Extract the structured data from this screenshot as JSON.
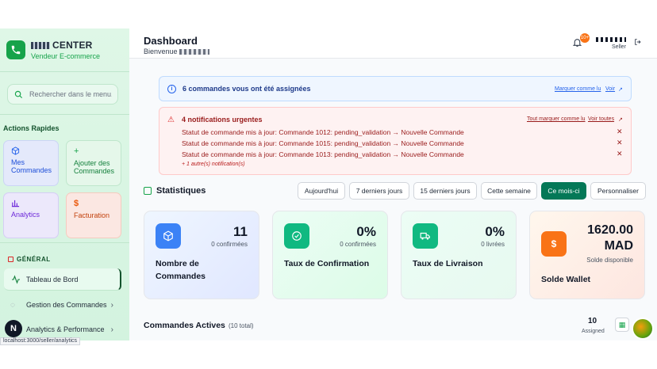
{
  "sidebar": {
    "brand_title": "CENTER",
    "brand_sub": "Vendeur E-commerce",
    "search_placeholder": "Rechercher dans le menu...",
    "quick_label": "Actions Rapides",
    "quick": [
      {
        "label": "Mes Commandes",
        "icon": "cube-icon"
      },
      {
        "label": "Ajouter des Commandes",
        "icon": "plus-icon"
      },
      {
        "label": "Analytics",
        "icon": "bar-chart-icon"
      },
      {
        "label": "Facturation",
        "icon": "dollar-icon"
      }
    ],
    "general_label": "GÉNÉRAL",
    "nav": [
      {
        "label": "Tableau de Bord",
        "active": true
      },
      {
        "label": "Gestion des Commandes"
      },
      {
        "label": "Analytics & Performance"
      }
    ],
    "badge": "N",
    "url_tip": "localhost:3000/seller/analytics"
  },
  "header": {
    "title": "Dashboard",
    "subtitle": "Bienvenue",
    "notif_count": "10+",
    "role": "Seller"
  },
  "info": {
    "text": "6 commandes vous ont été assignées",
    "mark_read": "Marquer comme lu",
    "view": "Voir"
  },
  "alert": {
    "title": "4 notifications urgentes",
    "mark_all": "Tout marquer comme lu",
    "view_all": "Voir toutes",
    "rows": [
      "Statut de commande mis à jour: Commande 1012: pending_validation → Nouvelle Commande",
      "Statut de commande mis à jour: Commande 1015: pending_validation → Nouvelle Commande",
      "Statut de commande mis à jour: Commande 1013: pending_validation → Nouvelle Commande"
    ],
    "more": "+ 1 autre(s) notification(s)"
  },
  "stats": {
    "title": "Statistiques",
    "periods": [
      "Aujourd'hui",
      "7 derniers jours",
      "15 derniers jours",
      "Cette semaine",
      "Ce mois-ci",
      "Personnaliser"
    ],
    "active_period": "Ce mois-ci",
    "cards": [
      {
        "value": "11",
        "sub": "0 confirmées",
        "label": "Nombre de Commandes"
      },
      {
        "value": "0%",
        "sub": "0 confirmées",
        "label": "Taux de Confirmation"
      },
      {
        "value": "0%",
        "sub": "0 livrées",
        "label": "Taux de Livraison"
      },
      {
        "value": "1620.00 MAD",
        "sub": "Solde disponible",
        "label": "Solde Wallet"
      }
    ]
  },
  "commands": {
    "title": "Commandes Actives",
    "total": "(10 total)",
    "assigned_count": "10",
    "assigned_label": "Assigned"
  }
}
